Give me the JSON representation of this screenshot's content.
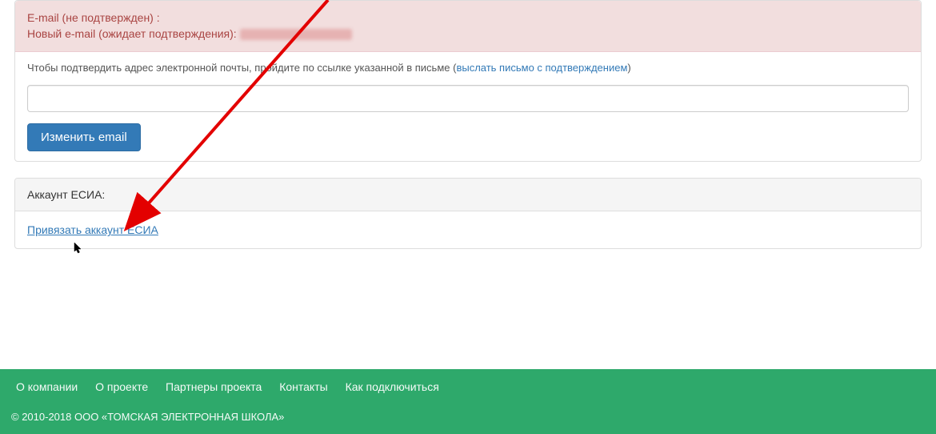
{
  "email_section": {
    "status_label": "E-mail (не подтвержден) :",
    "pending_label": "Новый e-mail (ожидает подтверждения):",
    "confirm_text_prefix": "Чтобы подтвердить адрес электронной почты, пройдите по ссылке указанной в письме (",
    "resend_link_text": "выслать письмо с подтверждением",
    "confirm_text_suffix": ")",
    "input_value": "",
    "change_button_label": "Изменить email"
  },
  "esia_section": {
    "header": "Аккаунт ЕСИА:",
    "link_text": "Привязать аккаунт ЕСИА"
  },
  "footer": {
    "links": [
      "О компании",
      "О проекте",
      "Партнеры проекта",
      "Контакты",
      "Как подключиться"
    ],
    "copyright": "© 2010-2018 ООО «ТОМСКАЯ ЭЛЕКТРОННАЯ ШКОЛА»"
  }
}
